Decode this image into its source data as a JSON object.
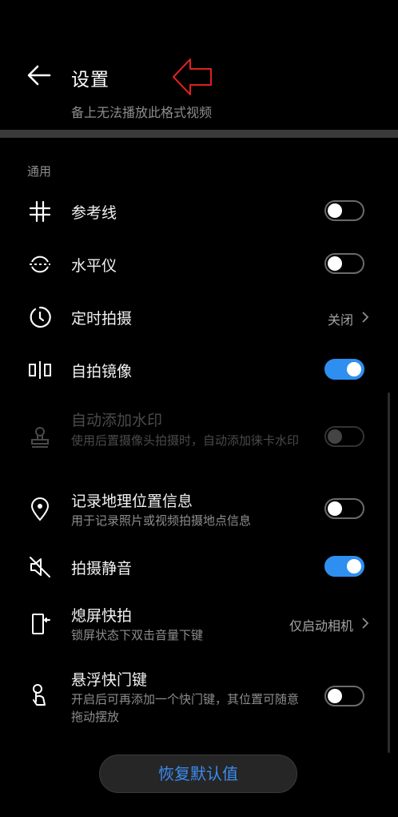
{
  "header": {
    "title": "设置",
    "subtitle": "备上无法播放此格式视频"
  },
  "section": {
    "label": "通用"
  },
  "items": [
    {
      "label": "参考线",
      "icon": "grid-icon",
      "control": "switch",
      "on": false
    },
    {
      "label": "水平仪",
      "icon": "level-icon",
      "control": "switch",
      "on": false
    },
    {
      "label": "定时拍摄",
      "icon": "timer-icon",
      "control": "value",
      "value": "关闭"
    },
    {
      "label": "自拍镜像",
      "icon": "mirror-icon",
      "control": "switch",
      "on": true
    },
    {
      "label": "自动添加水印",
      "description": "使用后置摄像头拍摄时，自动添加徕卡水印",
      "icon": "stamp-icon",
      "control": "switch",
      "on": false,
      "disabled": true
    },
    {
      "label": "记录地理位置信息",
      "description": "用于记录照片或视频拍摄地点信息",
      "icon": "location-icon",
      "control": "switch",
      "on": false
    },
    {
      "label": "拍摄静音",
      "icon": "mute-icon",
      "control": "switch",
      "on": true
    },
    {
      "label": "熄屏快拍",
      "description": "锁屏状态下双击音量下键",
      "icon": "quick-snap-icon",
      "control": "value",
      "value": "仅启动相机"
    },
    {
      "label": "悬浮快门键",
      "description": "开启后可再添加一个快门键，其位置可随意拖动摆放",
      "icon": "floating-shutter-icon",
      "control": "switch",
      "on": false
    }
  ],
  "restore_button": {
    "label": "恢复默认值"
  },
  "colors": {
    "accent": "#2f8ff0",
    "background": "#000000",
    "annotation_arrow": "#e02020"
  }
}
